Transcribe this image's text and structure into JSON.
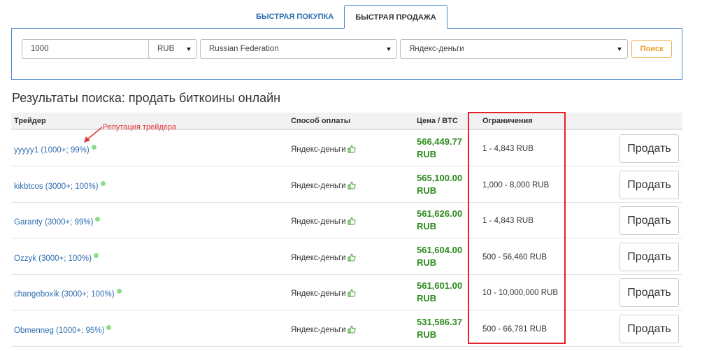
{
  "tabs": [
    {
      "label": "БЫСТРАЯ ПОКУПКА",
      "active": false
    },
    {
      "label": "БЫСТРАЯ ПРОДАЖА",
      "active": true
    }
  ],
  "search": {
    "amount": "1000",
    "currency": "RUB",
    "country": "Russian Federation",
    "payment_method": "Яндекс-деньги",
    "button_label": "Поиск"
  },
  "results": {
    "title": "Результаты поиска: продать биткоины онлайн",
    "headers": {
      "trader": "Трейдер",
      "method": "Способ оплаты",
      "price": "Цена / BTC",
      "limits": "Ограничения"
    },
    "annotation": "Репутация трейдера",
    "sell_label": "Продать",
    "rows": [
      {
        "trader": "yyyyy1 (1000+; 99%)",
        "method": "Яндекс-деньги",
        "price": "566,449.77",
        "currency": "RUB",
        "limit": "1 - 4,843 RUB"
      },
      {
        "trader": "kikbtcos (3000+; 100%)",
        "method": "Яндекс-деньги",
        "price": "565,100.00",
        "currency": "RUB",
        "limit": "1,000 - 8,000 RUB"
      },
      {
        "trader": "Garanty (3000+; 99%)",
        "method": "Яндекс-деньги",
        "price": "561,626.00",
        "currency": "RUB",
        "limit": "1 - 4,843 RUB"
      },
      {
        "trader": "Ozzyk (3000+; 100%)",
        "method": "Яндекс-деньги",
        "price": "561,604.00",
        "currency": "RUB",
        "limit": "500 - 56,460 RUB"
      },
      {
        "trader": "changeboxik (3000+; 100%)",
        "method": "Яндекс-деньги",
        "price": "561,601.00",
        "currency": "RUB",
        "limit": "10 - 10,000,000 RUB"
      },
      {
        "trader": "Obmenneg (1000+; 95%)",
        "method": "Яндекс-деньги",
        "price": "531,586.37",
        "currency": "RUB",
        "limit": "500 - 66,781 RUB"
      }
    ]
  },
  "colors": {
    "accent": "#2f6fb0",
    "price_green": "#2e8b1f",
    "highlight_red": "#e8202a",
    "search_orange": "#f0ad4e",
    "online_dot": "#8bdc8b"
  },
  "icons": {
    "thumb": "thumbs-up-icon",
    "dot": "online-status-icon",
    "arrow": "annotation-arrow-icon",
    "chevron": "chevron-down-icon"
  }
}
